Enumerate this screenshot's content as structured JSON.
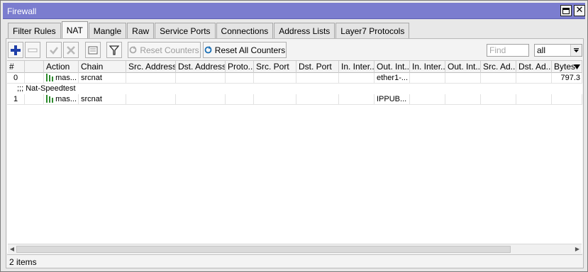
{
  "window": {
    "title": "Firewall"
  },
  "tabs": [
    {
      "label": "Filter Rules",
      "active": false
    },
    {
      "label": "NAT",
      "active": true
    },
    {
      "label": "Mangle",
      "active": false
    },
    {
      "label": "Raw",
      "active": false
    },
    {
      "label": "Service Ports",
      "active": false
    },
    {
      "label": "Connections",
      "active": false
    },
    {
      "label": "Address Lists",
      "active": false
    },
    {
      "label": "Layer7 Protocols",
      "active": false
    }
  ],
  "toolbar": {
    "reset_counters_label": "Reset Counters",
    "reset_all_counters_label": "Reset All Counters",
    "find_placeholder": "Find",
    "filter_select_value": "all"
  },
  "table": {
    "columns": [
      "#",
      "",
      "Action",
      "Chain",
      "Src. Address",
      "Dst. Address",
      "Proto...",
      "Src. Port",
      "Dst. Port",
      "In. Inter...",
      "Out. Int...",
      "In. Inter...",
      "Out. Int...",
      "Src. Ad...",
      "Dst. Ad...",
      "Bytes"
    ],
    "rows": [
      {
        "num": "0",
        "action": "mas...",
        "chain": "srcnat",
        "out_interface": "ether1-...",
        "bytes": "797.3"
      },
      {
        "comment": ";;; Nat-Speedtest"
      },
      {
        "num": "1",
        "action": "mas...",
        "chain": "srcnat",
        "out_interface": "IPPUB...",
        "bytes": ""
      }
    ]
  },
  "status": {
    "items_text": "2 items"
  }
}
